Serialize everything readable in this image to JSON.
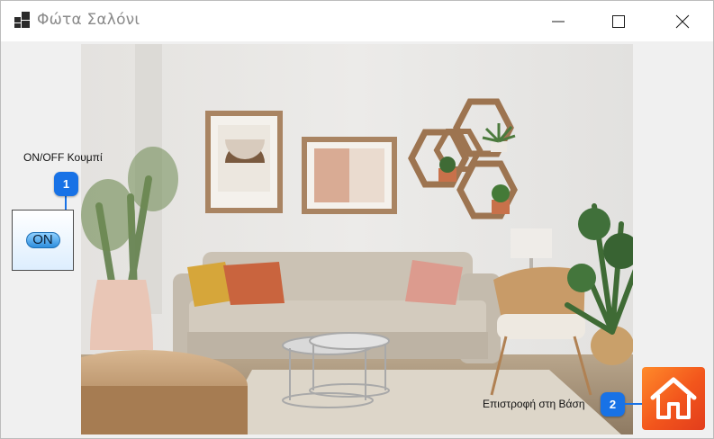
{
  "window": {
    "title": "Φώτα Σαλόνι",
    "app_icon": "app-tiles-icon",
    "controls": [
      "minimize-icon",
      "maximize-icon",
      "close-icon"
    ]
  },
  "photo": {
    "subject": "living-room-photo"
  },
  "toggle": {
    "label": "ON/OFF Κουμπί",
    "state_text": "ON",
    "badge": "1"
  },
  "home": {
    "label": "Επιστροφή στη Βάση",
    "badge": "2",
    "icon": "home-icon"
  },
  "colors": {
    "badge_blue": "#1872e6",
    "home_orange": "#f2551c"
  }
}
